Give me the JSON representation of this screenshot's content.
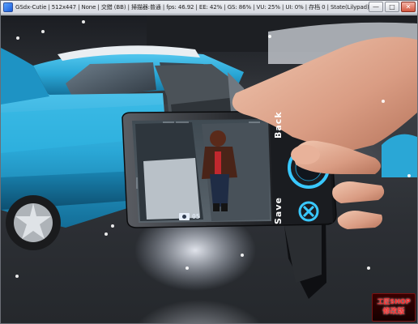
{
  "window": {
    "title": "GSdx-Cutie | 512x447 | None | 交錯 (BB) | 掃描器:普通 | fps: 46.92 | EE: 42% | GS: 86% | VU: 25% | UI: 0% | 存档 0 | State(Lilypad) 0",
    "minimize_label": "—",
    "maximize_label": "□",
    "close_label": "✕"
  },
  "phone": {
    "back_label": "Back",
    "save_label": "Save",
    "photo_count": "05",
    "back_button_icon": "circle-select-icon",
    "save_button_icon": "cross-x-icon",
    "camera_icon": "camera-icon"
  },
  "logo": {
    "line1": "工匠SHOP",
    "line2": "修改版"
  },
  "colors": {
    "car_body": "#2aa7d6",
    "hud_accent": "#39c8ff",
    "logo_red": "#ff2b2b"
  }
}
